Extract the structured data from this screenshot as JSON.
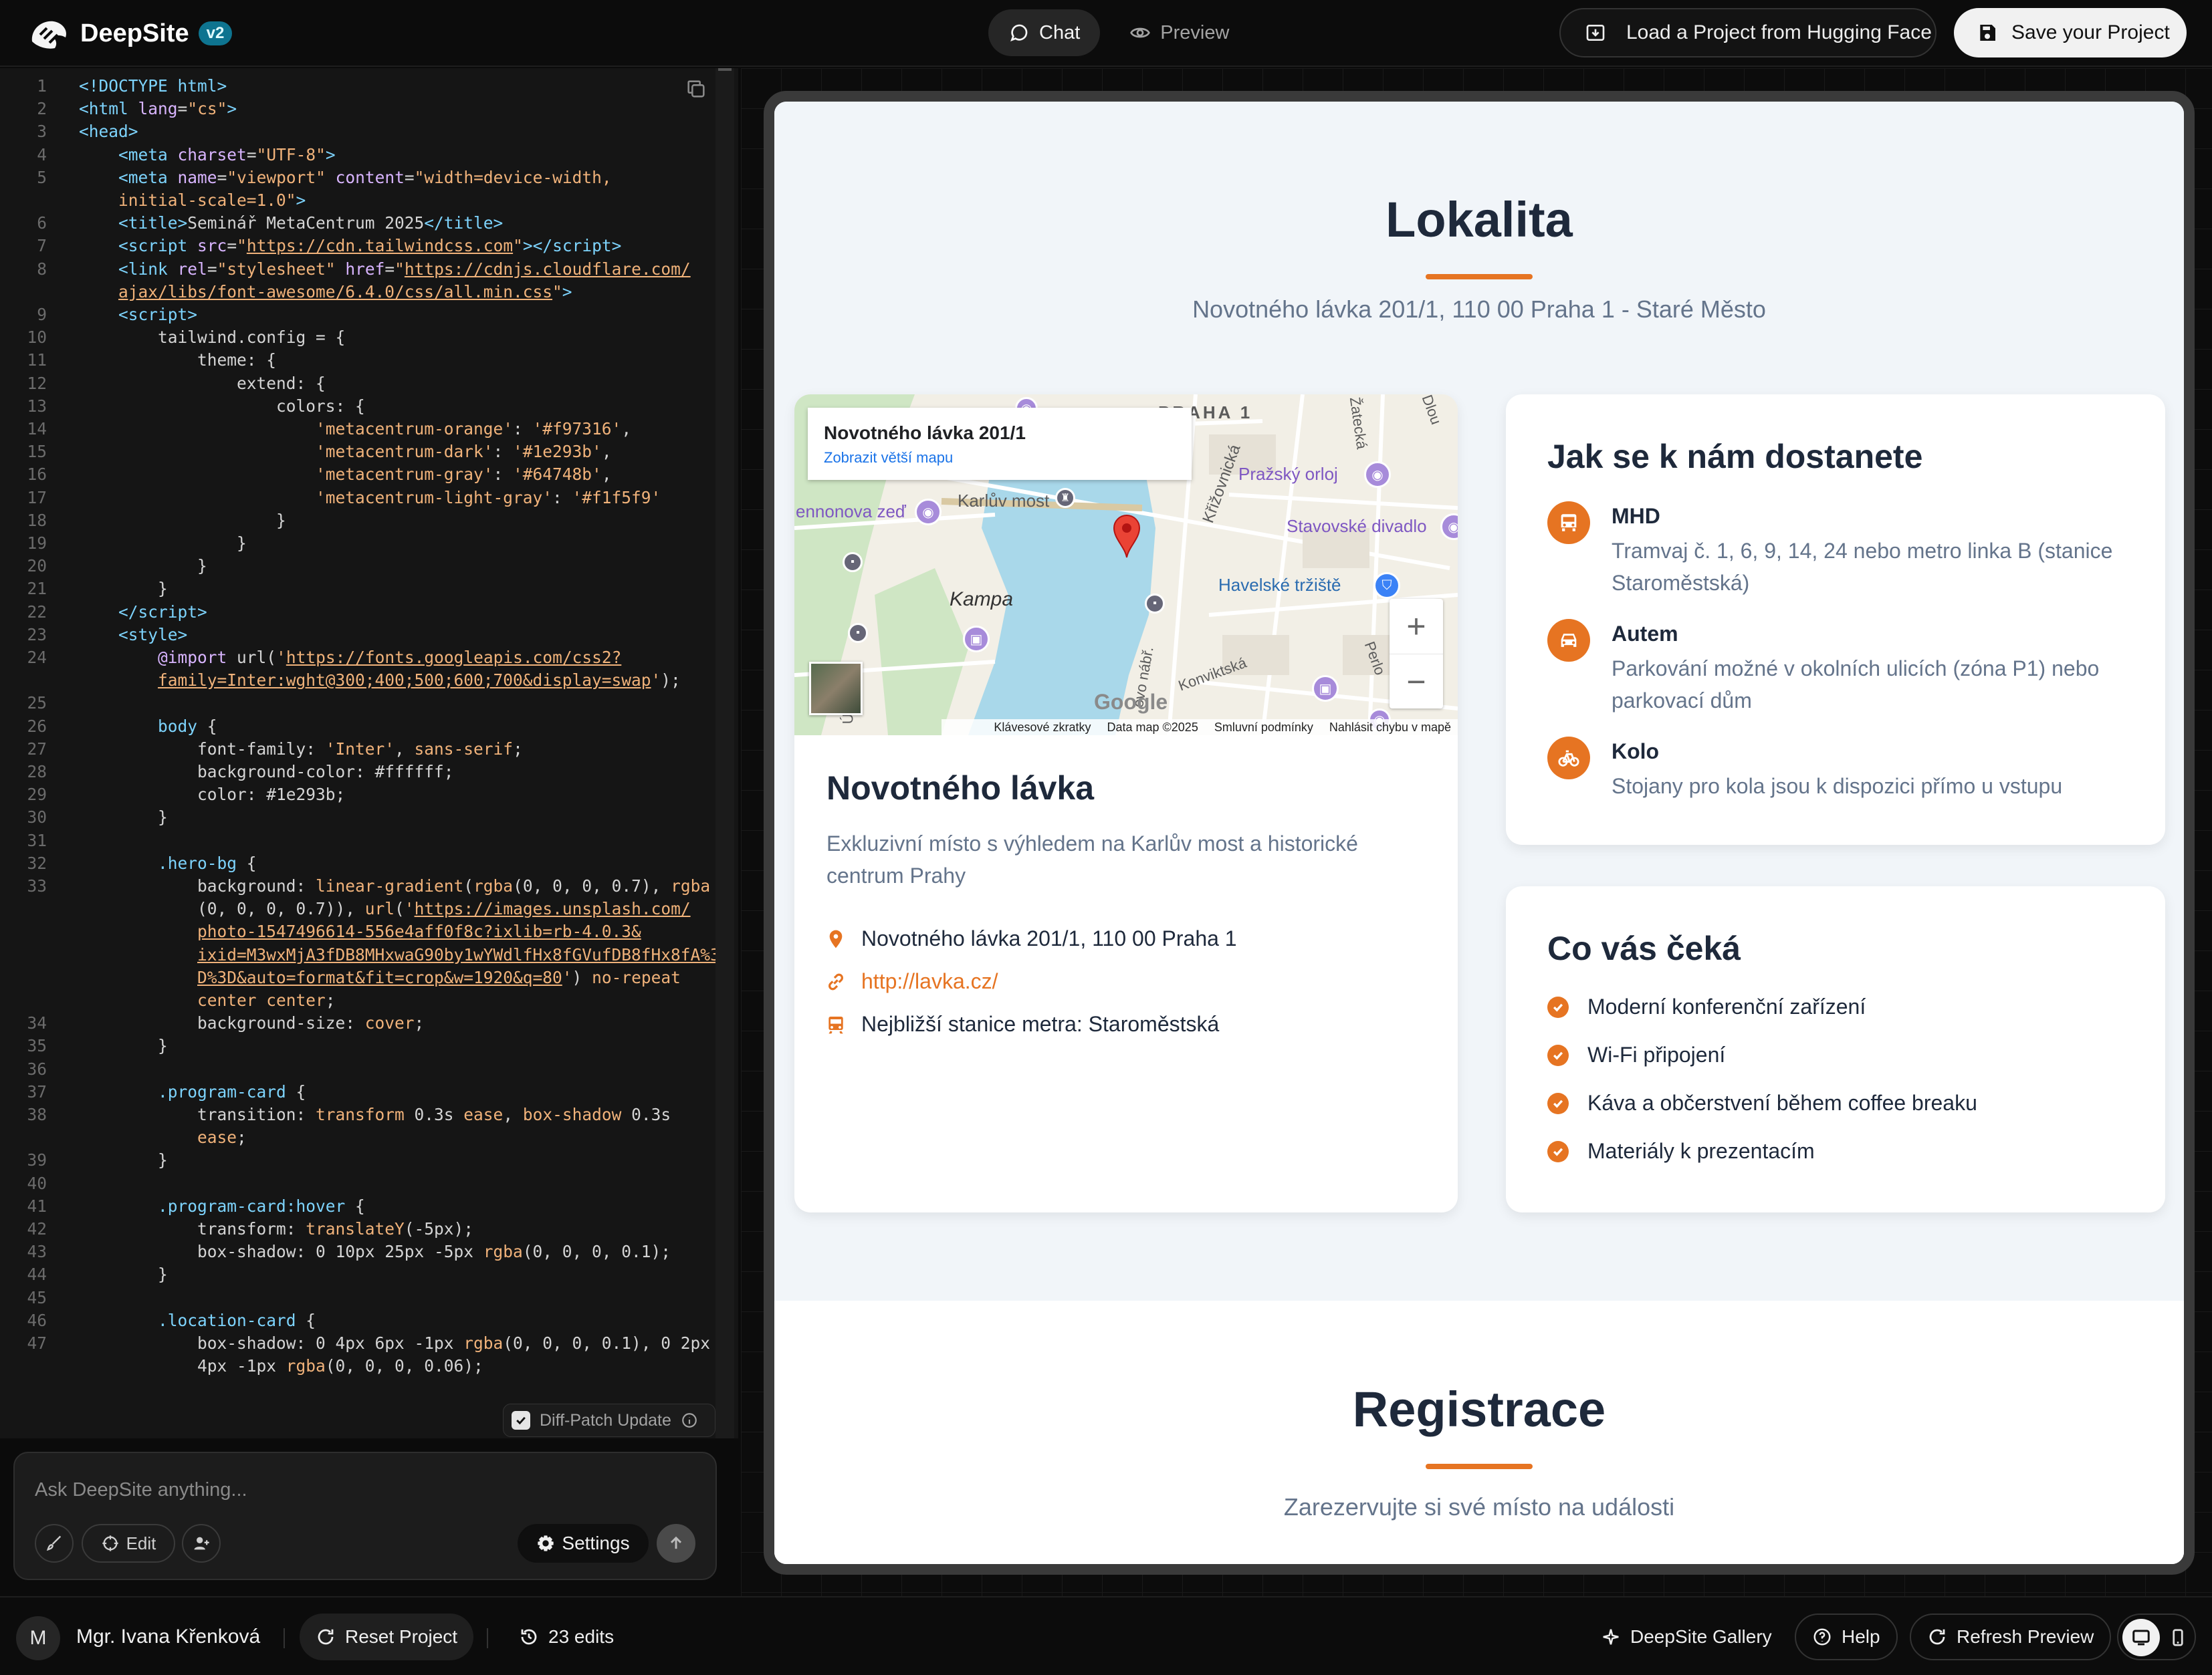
{
  "header": {
    "brand": "DeepSite",
    "version": "v2",
    "tabs": [
      {
        "label": "Chat",
        "active": true
      },
      {
        "label": "Preview",
        "active": false
      }
    ],
    "load_label": "Load a Project from Hugging Face",
    "save_label": "Save your Project"
  },
  "editor": {
    "lines": [
      {
        "n": "1",
        "html": "<span class='t-tag'>&lt;!DOCTYPE html&gt;</span>"
      },
      {
        "n": "2",
        "html": "<span class='t-tag'>&lt;html</span> <span class='t-attr'>lang</span>=<span class='t-str'>\"cs\"</span><span class='t-tag'>&gt;</span>"
      },
      {
        "n": "3",
        "html": "<span class='t-tag'>&lt;head&gt;</span>"
      },
      {
        "n": "4",
        "html": "    <span class='t-tag'>&lt;meta</span> <span class='t-attr'>charset</span>=<span class='t-str'>\"UTF-8\"</span><span class='t-tag'>&gt;</span>"
      },
      {
        "n": "5",
        "html": "    <span class='t-tag'>&lt;meta</span> <span class='t-attr'>name</span>=<span class='t-str'>\"viewport\"</span> <span class='t-attr'>content</span>=<span class='t-str'>\"width=device-width,</span>"
      },
      {
        "n": "",
        "html": "    <span class='t-str'>initial-scale=1.0\"</span><span class='t-tag'>&gt;</span>"
      },
      {
        "n": "6",
        "html": "    <span class='t-tag'>&lt;title&gt;</span>Seminář MetaCentrum 2025<span class='t-tag'>&lt;/title&gt;</span>"
      },
      {
        "n": "7",
        "html": "    <span class='t-tag'>&lt;script</span> <span class='t-attr'>src</span>=<span class='t-str'>\"<span class='t-url'>https://cdn.tailwindcss.com</span>\"</span><span class='t-tag'>&gt;&lt;/script&gt;</span>"
      },
      {
        "n": "8",
        "html": "    <span class='t-tag'>&lt;link</span> <span class='t-attr'>rel</span>=<span class='t-str'>\"stylesheet\"</span> <span class='t-attr'>href</span>=<span class='t-str'>\"<span class='t-url'>https://cdnjs.cloudflare.com/</span></span>"
      },
      {
        "n": "",
        "html": "    <span class='t-str'><span class='t-url'>ajax/libs/font-awesome/6.4.0/css/all.min.css</span>\"</span><span class='t-tag'>&gt;</span>"
      },
      {
        "n": "9",
        "html": "    <span class='t-tag'>&lt;script&gt;</span>"
      },
      {
        "n": "10",
        "html": "        tailwind.config = {"
      },
      {
        "n": "11",
        "html": "            theme: {"
      },
      {
        "n": "12",
        "html": "                extend: {"
      },
      {
        "n": "13",
        "html": "                    colors: {"
      },
      {
        "n": "14",
        "html": "                        <span class='t-str'>'metacentrum-orange'</span>: <span class='t-str'>'#f97316'</span>,"
      },
      {
        "n": "15",
        "html": "                        <span class='t-str'>'metacentrum-dark'</span>: <span class='t-str'>'#1e293b'</span>,"
      },
      {
        "n": "16",
        "html": "                        <span class='t-str'>'metacentrum-gray'</span>: <span class='t-str'>'#64748b'</span>,"
      },
      {
        "n": "17",
        "html": "                        <span class='t-str'>'metacentrum-light-gray'</span>: <span class='t-str'>'#f1f5f9'</span>"
      },
      {
        "n": "18",
        "html": "                    }"
      },
      {
        "n": "19",
        "html": "                }"
      },
      {
        "n": "20",
        "html": "            }"
      },
      {
        "n": "21",
        "html": "        }"
      },
      {
        "n": "22",
        "html": "    <span class='t-tag'>&lt;/script&gt;</span>"
      },
      {
        "n": "23",
        "html": "    <span class='t-tag'>&lt;style&gt;</span>"
      },
      {
        "n": "24",
        "html": "        <span class='t-attr'>@import</span> url(<span class='t-str'>'<span class='t-url'>https://fonts.googleapis.com/css2?</span></span>"
      },
      {
        "n": "",
        "html": "        <span class='t-str'><span class='t-url'>family=Inter:wght@300;400;500;600;700&amp;display=swap</span>'</span>);"
      },
      {
        "n": "25",
        "html": ""
      },
      {
        "n": "26",
        "html": "        <span class='t-sel'>body</span> {"
      },
      {
        "n": "27",
        "html": "            font-family: <span class='t-str'>'Inter'</span>, <span class='t-str'>sans-serif</span>;"
      },
      {
        "n": "28",
        "html": "            background-color: #ffffff;"
      },
      {
        "n": "29",
        "html": "            color: #1e293b;"
      },
      {
        "n": "30",
        "html": "        }"
      },
      {
        "n": "31",
        "html": ""
      },
      {
        "n": "32",
        "html": "        <span class='t-sel'>.hero-bg</span> {"
      },
      {
        "n": "33",
        "html": "            background: <span class='t-str'>linear-gradient</span>(<span class='t-str'>rgba</span>(0, 0, 0, 0.7), <span class='t-str'>rgba</span>"
      },
      {
        "n": "",
        "html": "            (0, 0, 0, 0.7)), <span class='t-str'>url</span>(<span class='t-str'>'<span class='t-url'>https://images.unsplash.com/</span></span>"
      },
      {
        "n": "",
        "html": "            <span class='t-str'><span class='t-url'>photo-1547496614-556e4aff0f8c?ixlib=rb-4.0.3&amp;</span></span>"
      },
      {
        "n": "",
        "html": "            <span class='t-str'><span class='t-url'>ixid=M3wxMjA3fDB8MHxwaG90by1wYWdlfHx8fGVufDB8fHx8fA%3</span></span>"
      },
      {
        "n": "",
        "html": "            <span class='t-str'><span class='t-url'>D%3D&amp;auto=format&amp;fit=crop&amp;w=1920&amp;q=80</span>'</span>) <span class='t-str'>no-repeat</span>"
      },
      {
        "n": "",
        "html": "            <span class='t-str'>center center</span>;"
      },
      {
        "n": "34",
        "html": "            background-size: <span class='t-str'>cover</span>;"
      },
      {
        "n": "35",
        "html": "        }"
      },
      {
        "n": "36",
        "html": ""
      },
      {
        "n": "37",
        "html": "        <span class='t-sel'>.program-card</span> {"
      },
      {
        "n": "38",
        "html": "            transition: <span class='t-str'>transform</span> 0.3s <span class='t-str'>ease</span>, <span class='t-str'>box-shadow</span> 0.3s"
      },
      {
        "n": "",
        "html": "            <span class='t-str'>ease</span>;"
      },
      {
        "n": "39",
        "html": "        }"
      },
      {
        "n": "40",
        "html": ""
      },
      {
        "n": "41",
        "html": "        <span class='t-sel'>.program-card:hover</span> {"
      },
      {
        "n": "42",
        "html": "            transform: <span class='t-str'>translateY</span>(-5px);"
      },
      {
        "n": "43",
        "html": "            box-shadow: 0 10px 25px -5px <span class='t-str'>rgba</span>(0, 0, 0, 0.1);"
      },
      {
        "n": "44",
        "html": "        }"
      },
      {
        "n": "45",
        "html": ""
      },
      {
        "n": "46",
        "html": "        <span class='t-sel'>.location-card</span> {"
      },
      {
        "n": "47",
        "html": "            box-shadow: 0 4px 6px -1px <span class='t-str'>rgba</span>(0, 0, 0, 0.1), 0 2px"
      },
      {
        "n": "",
        "html": "            4px -1px <span class='t-str'>rgba</span>(0, 0, 0, 0.06);"
      }
    ],
    "diff_patch_label": "Diff-Patch Update"
  },
  "chat": {
    "placeholder": "Ask DeepSite anything...",
    "edit_label": "Edit",
    "settings_label": "Settings"
  },
  "site": {
    "location": {
      "title": "Lokalita",
      "subtitle": "Novotného lávka 201/1, 110 00 Praha 1 - Staré Město"
    },
    "map": {
      "info_title": "Novotného lávka 201/1",
      "info_link": "Zobrazit větší mapu",
      "labels": {
        "praha1": "PRAHA 1",
        "karluv_most": "Karlův most",
        "prazsky_orloj": "Pražský orloj",
        "stavovske_divadlo": "Stavovské divadlo",
        "havelske_trziste": "Havelské tržiště",
        "kampa": "Kampa",
        "lennonova_zed": "ennonova zeď",
        "krizovnicka": "Křižovnická",
        "zatecka": "Žatecká",
        "konviktska": "Konviktská",
        "smetanovo": "ovo nábř.",
        "perlova": "Perlo",
        "dlouha": "Dlou",
        "ujezd": "Új"
      },
      "google_logo": "Google",
      "footer": [
        "Klávesové zkratky",
        "Data map ©2025",
        "Smluvní podmínky",
        "Nahlásit chybu v mapě"
      ]
    },
    "venue": {
      "title": "Novotného lávka",
      "description": "Exkluzivní místo s výhledem na Karlův most a historické centrum Prahy",
      "address": "Novotného lávka 201/1, 110 00 Praha 1",
      "link": "http://lavka.cz/",
      "metro": "Nejbližší stanice metra: Staroměstská"
    },
    "transport": {
      "title": "Jak se k nám dostanete",
      "items": [
        {
          "title": "MHD",
          "desc": "Tramvaj č. 1, 6, 9, 14, 24 nebo metro linka B (stanice Staroměstská)"
        },
        {
          "title": "Autem",
          "desc": "Parkování možné v okolních ulicích (zóna P1) nebo parkovací dům"
        },
        {
          "title": "Kolo",
          "desc": "Stojany pro kola jsou k dispozici přímo u vstupu"
        }
      ]
    },
    "expect": {
      "title": "Co vás čeká",
      "items": [
        "Moderní konferenční zařízení",
        "Wi-Fi připojení",
        "Káva a občerstvení během coffee breaku",
        "Materiály k prezentacím"
      ]
    },
    "registration": {
      "title": "Registrace",
      "subtitle": "Zarezervujte si své místo na události"
    }
  },
  "footer": {
    "avatar_letter": "M",
    "user_name": "Mgr. Ivana Křenková",
    "reset_label": "Reset Project",
    "edits_label": "23 edits",
    "gallery_label": "DeepSite Gallery",
    "help_label": "Help",
    "refresh_label": "Refresh Preview"
  },
  "colors": {
    "accent": "#e67422",
    "dark": "#1e293b",
    "gray": "#64748b",
    "light_gray": "#f1f5f9"
  }
}
